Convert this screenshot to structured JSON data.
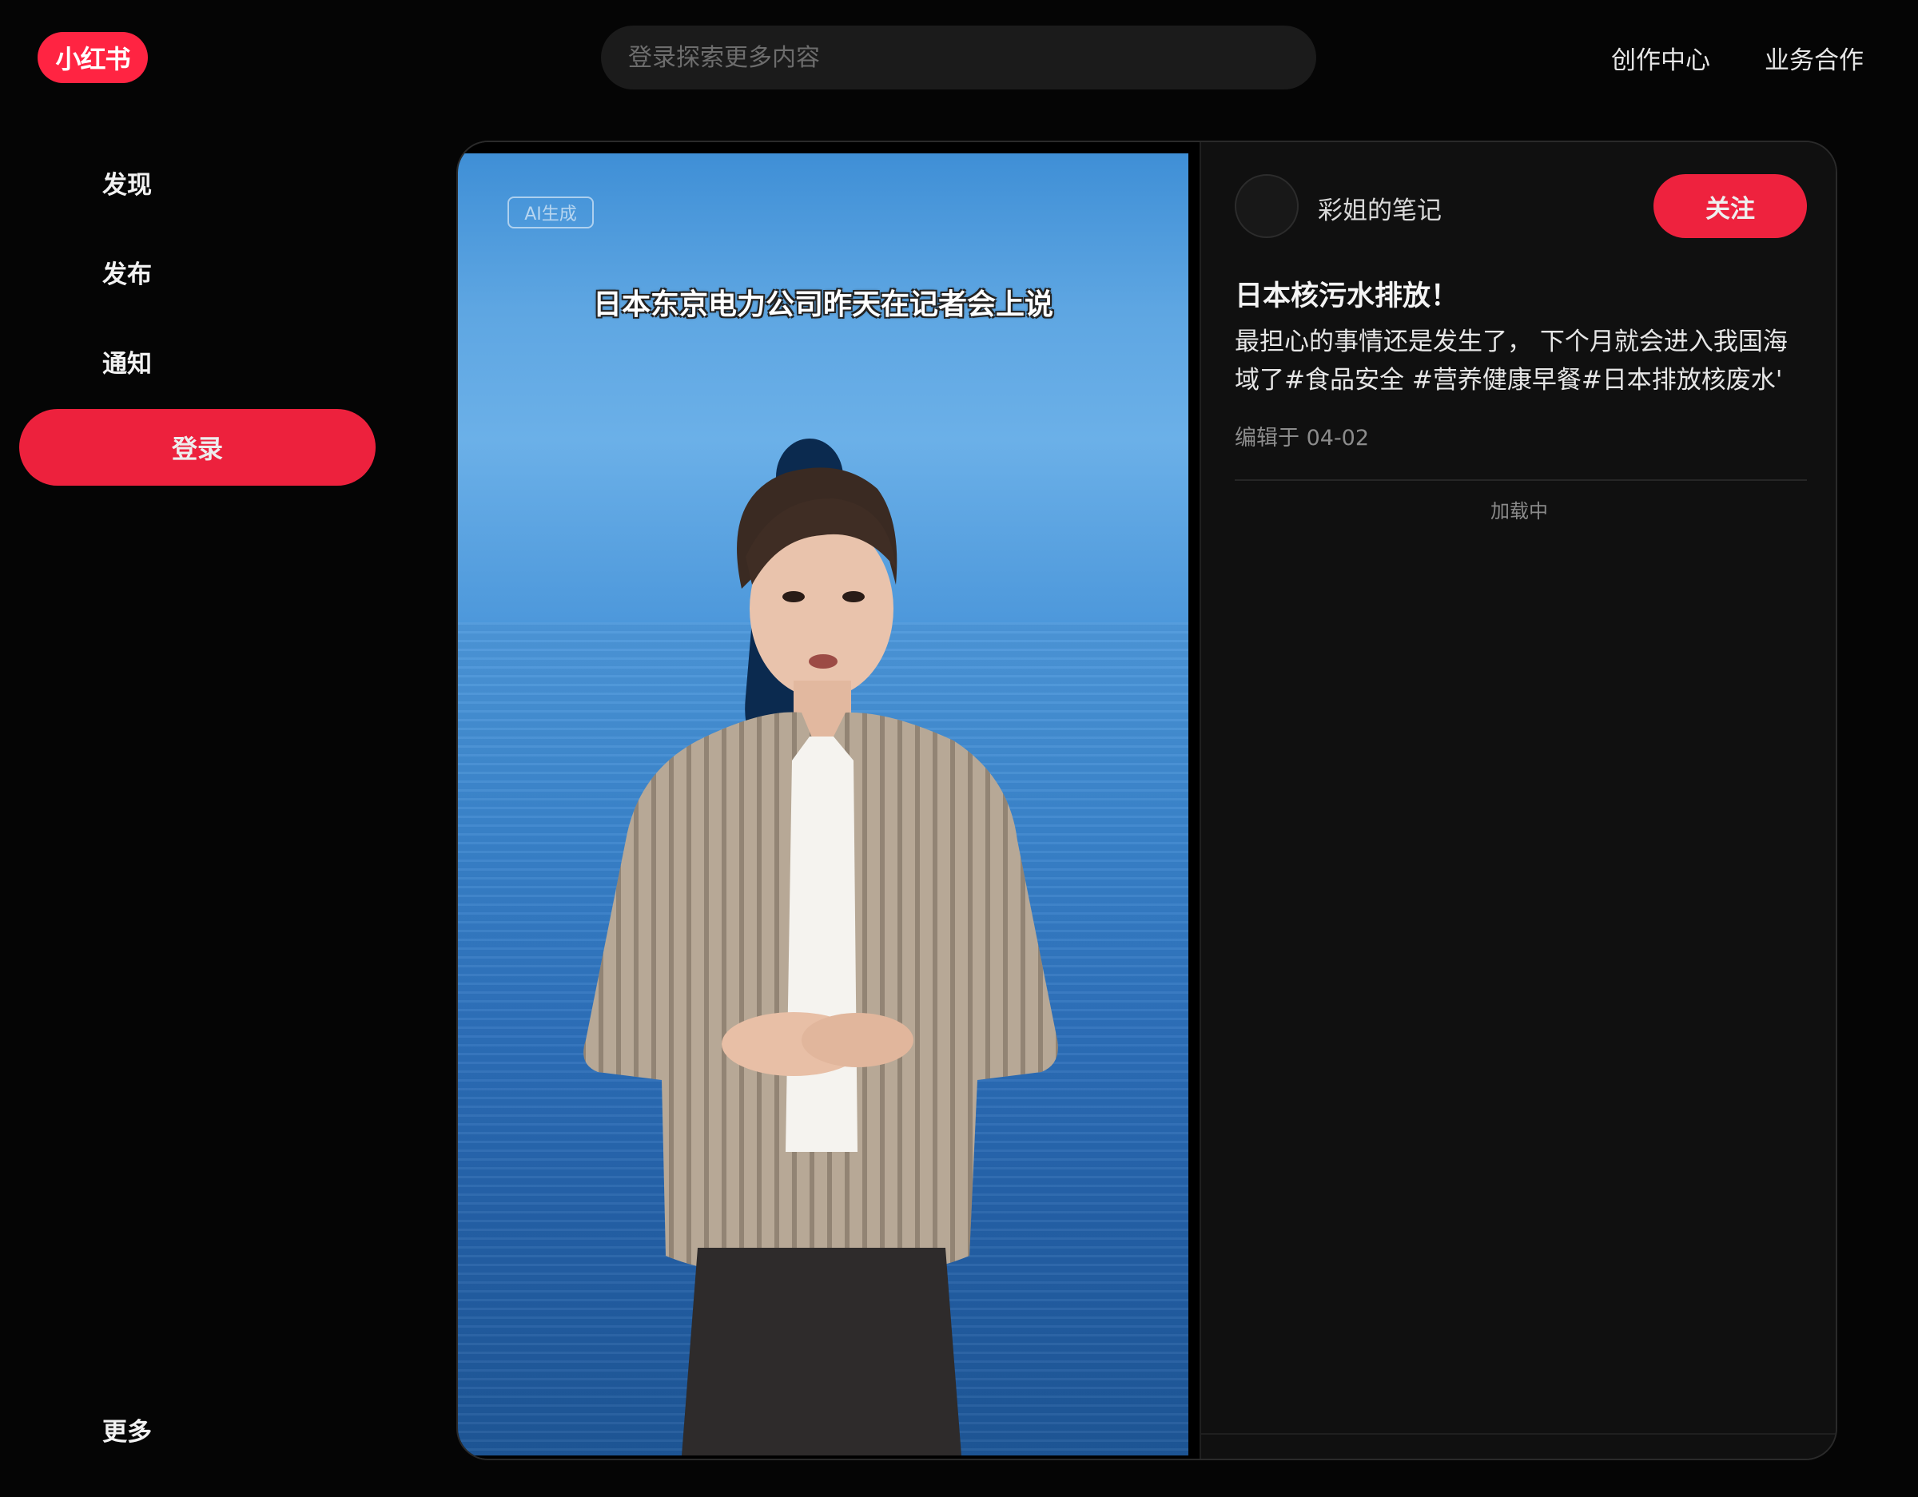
{
  "header": {
    "logo_text": "小红书",
    "search_placeholder": "登录探索更多内容",
    "links": {
      "creator": "创作中心",
      "business": "业务合作"
    }
  },
  "sidebar": {
    "items": [
      {
        "label": "发现"
      },
      {
        "label": "发布"
      },
      {
        "label": "通知"
      }
    ],
    "login_label": "登录",
    "more_label": "更多"
  },
  "video": {
    "ai_badge": "AI生成",
    "subtitle": "日本东京电力公司昨天在记者会上说"
  },
  "note": {
    "author": "彩姐的笔记",
    "follow_label": "关注",
    "title": "日本核污水排放！",
    "desc_text": "最担心的事情还是发生了， 下个月就会进入我国海域了",
    "tags": [
      "#食品安全",
      "#营养健康早餐",
      "#日本排放核废水"
    ],
    "desc_tail": "'",
    "date": "编辑于 04-02",
    "loading": "加载中"
  },
  "colors": {
    "brand": "#ff2442",
    "background": "#050505",
    "panel": "#101010",
    "search_bg": "#1b1b1b"
  }
}
